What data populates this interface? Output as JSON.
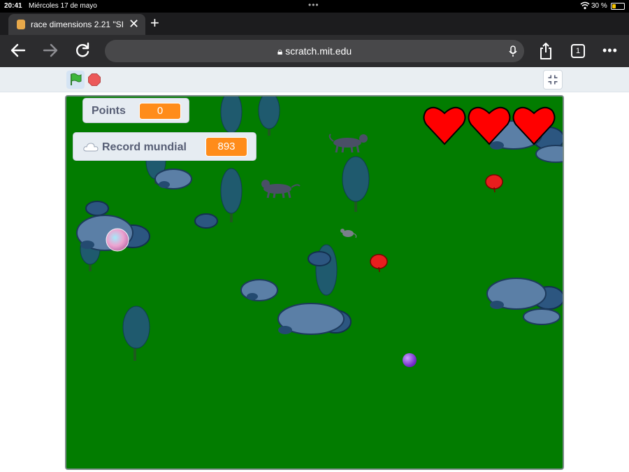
{
  "status_bar": {
    "time": "20:41",
    "date": "Miércoles 17 de mayo",
    "battery": "30 %",
    "battery_level": 0.3
  },
  "browser": {
    "tab_title": "race dimensions 2.21 \"SI",
    "url": "scratch.mit.edu",
    "tab_count": "1"
  },
  "scratch": {
    "monitors": {
      "points_label": "Points",
      "points_value": "0",
      "record_label": "Record mundial",
      "record_value": "893"
    },
    "lives": 3
  },
  "colors": {
    "stage_green": "#027c00",
    "monitor_orange": "#ff8c1a",
    "heart_red": "#ff0000",
    "rock_blue": "#5b7fa6"
  }
}
